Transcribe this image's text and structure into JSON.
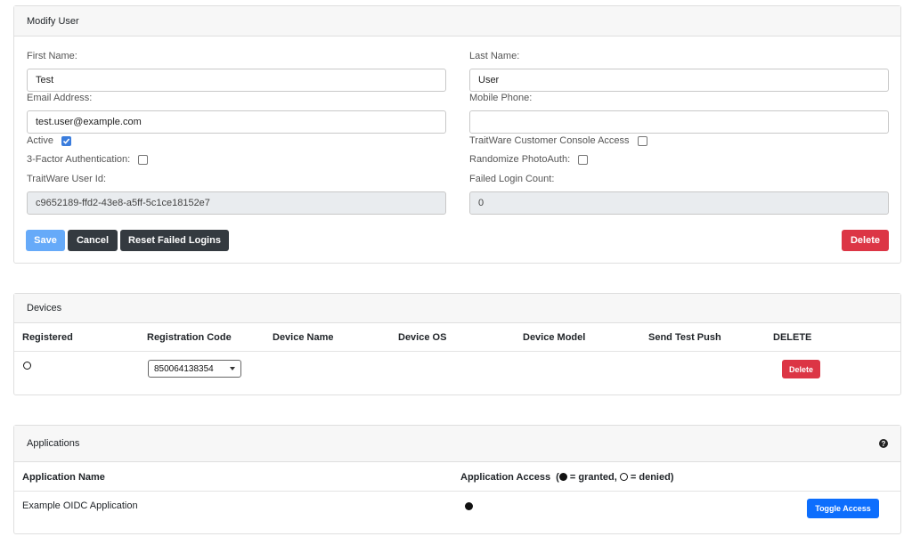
{
  "modify_user": {
    "title": "Modify User",
    "first_name": {
      "label": "First Name:",
      "value": "Test"
    },
    "last_name": {
      "label": "Last Name:",
      "value": "User"
    },
    "email": {
      "label": "Email Address:",
      "value": "test.user@example.com"
    },
    "mobile": {
      "label": "Mobile Phone:",
      "value": ""
    },
    "active": {
      "label": "Active",
      "checked": true
    },
    "console_access": {
      "label": "TraitWare Customer Console Access",
      "checked": false
    },
    "three_factor": {
      "label": "3-Factor Authentication:",
      "checked": false
    },
    "randomize_photoauth": {
      "label": "Randomize PhotoAuth:",
      "checked": false
    },
    "user_id": {
      "label": "TraitWare User Id:",
      "value": "c9652189-ffd2-43e8-a5ff-5c1ce18152e7"
    },
    "failed_login": {
      "label": "Failed Login Count:",
      "value": "0"
    },
    "buttons": {
      "save": "Save",
      "cancel": "Cancel",
      "reset": "Reset Failed Logins",
      "delete": "Delete"
    }
  },
  "devices": {
    "title": "Devices",
    "columns": [
      "Registered",
      "Registration Code",
      "Device Name",
      "Device OS",
      "Device Model",
      "Send Test Push",
      "DELETE"
    ],
    "rows": [
      {
        "registered": false,
        "registration_code": "850064138354",
        "device_name": "",
        "device_os": "",
        "device_model": "",
        "delete_label": "Delete"
      }
    ]
  },
  "applications": {
    "title": "Applications",
    "help_icon": "question-circle-icon",
    "columns": {
      "name": "Application Name",
      "access_prefix": "Application Access  (",
      "granted": " = granted, ",
      "denied": " = denied)"
    },
    "rows": [
      {
        "name": "Example OIDC Application",
        "granted": true,
        "toggle_label": "Toggle Access"
      }
    ]
  },
  "colors": {
    "primary": "#0d6efd",
    "danger": "#dc3545",
    "dark": "#343a40",
    "save": "#66aaf9"
  }
}
